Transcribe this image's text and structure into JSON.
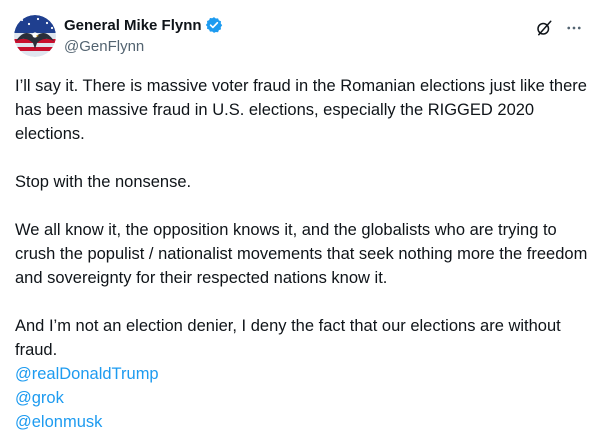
{
  "author": {
    "display_name": "General Mike Flynn",
    "handle": "@GenFlynn",
    "verified": true
  },
  "icons": {
    "avatar": "eagle-flag-avatar",
    "verified": "verified-badge-icon",
    "grok": "grok-icon",
    "more": "more-options-icon"
  },
  "colors": {
    "text": "#0f1419",
    "secondary": "#536471",
    "link": "#1d9bf0",
    "verified": "#1d9bf0"
  },
  "tweet": {
    "paragraphs": [
      "I’ll say it. There is massive voter fraud in the Romanian elections just like there has been massive fraud in U.S. elections, especially the RIGGED 2020 elections.",
      "Stop with the nonsense.",
      "We all know it, the opposition knows it, and the globalists who are trying to crush the populist / nationalist movements that seek nothing more the freedom and sovereignty for their respected nations know it.",
      "And I’m not an election denier, I deny the fact that our elections are without fraud."
    ],
    "mentions": [
      "@realDonaldTrump",
      "@grok",
      "@elonmusk"
    ]
  }
}
